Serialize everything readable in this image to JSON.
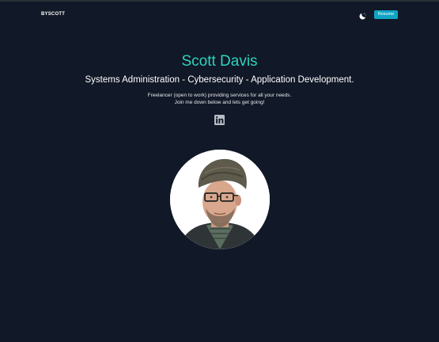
{
  "nav": {
    "brand": "BYSCOTT",
    "theme_icon": "moon-icon",
    "resume_label": "Resume"
  },
  "hero": {
    "name": "Scott Davis",
    "subtitle": "Systems Administration - Cybersecurity - Application Development.",
    "tagline_line1": "Freelancer (open to work) providing services for all your needs.",
    "tagline_line2": "Join me down below and lets get going!"
  },
  "social": {
    "linkedin_icon": "linkedin-icon"
  },
  "colors": {
    "background": "#111827",
    "accent": "#2dd4bf",
    "button": "#0ea5c4"
  }
}
